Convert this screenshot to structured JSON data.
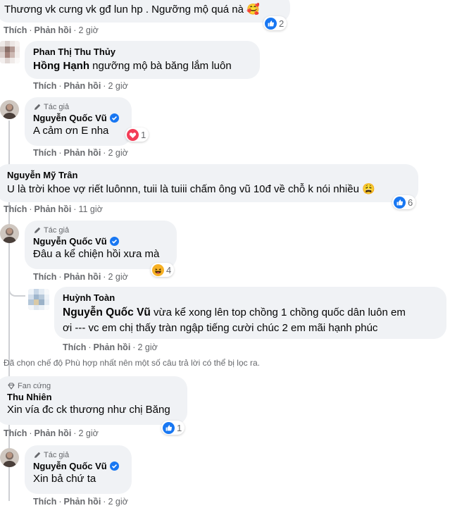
{
  "comments": [
    {
      "id": "c0",
      "text": "Thương vk cưng vk gđ lun hp . Ngưỡng mộ quá nà 🥰",
      "reaction_count": "2",
      "reaction_icon": "like-icon",
      "actions": {
        "like": "Thích",
        "reply": "Phản hồi",
        "time": "2 giờ"
      }
    },
    {
      "id": "c1",
      "author": "Phan Thị Thu Thủy",
      "mention": "Hồng Hạnh",
      "text": "ngưỡng mộ bà băng lắm luôn",
      "actions": {
        "like": "Thích",
        "reply": "Phản hồi",
        "time": "2 giờ"
      }
    },
    {
      "id": "c2",
      "badge": "Tác giả",
      "author": "Nguyễn Quốc Vũ",
      "text": "A cảm ơn E nha",
      "reaction_count": "1",
      "reaction_icon": "love-icon",
      "actions": {
        "like": "Thích",
        "reply": "Phản hồi",
        "time": "2 giờ"
      }
    },
    {
      "id": "c3",
      "author": "Nguyễn Mỹ Trân",
      "text": "U là trời khoe vợ riết luônnn, tuii là tuiii chấm ông vũ 10đ về chỗ k nói nhiều 😩",
      "reaction_count": "6",
      "reaction_icon": "like-icon",
      "actions": {
        "like": "Thích",
        "reply": "Phản hồi",
        "time": "11 giờ"
      }
    },
    {
      "id": "c4",
      "badge": "Tác giả",
      "author": "Nguyễn Quốc Vũ",
      "text": "Đâu a kể chiện hồi xưa mà",
      "reaction_count": "4",
      "reaction_icon": "haha-icon",
      "actions": {
        "like": "Thích",
        "reply": "Phản hồi",
        "time": "2 giờ"
      }
    },
    {
      "id": "c5",
      "author": "Huỳnh Toàn",
      "mention": "Nguyễn Quốc Vũ",
      "text_line1": "vừa kể xong lên top chồng 1 chồng quốc dân luôn em",
      "text_line2": "ơi --- vc em chị thấy tràn ngập tiếng cười chúc 2 em mãi hạnh phúc",
      "actions": {
        "like": "Thích",
        "reply": "Phản hồi",
        "time": "2 giờ"
      }
    },
    {
      "id": "c6",
      "badge": "Fan cứng",
      "author": "Thu Nhiên",
      "text": "Xin vía đc ck thương như chị Băng",
      "reaction_count": "1",
      "reaction_icon": "like-icon",
      "actions": {
        "like": "Thích",
        "reply": "Phản hồi",
        "time": "2 giờ"
      }
    },
    {
      "id": "c7",
      "badge": "Tác giả",
      "author": "Nguyễn Quốc Vũ",
      "text": "Xin bả chứ ta",
      "actions": {
        "like": "Thích",
        "reply": "Phản hồi",
        "time": "2 giờ"
      }
    }
  ],
  "filter_notice": "Đã chọn chế độ Phù hợp nhất nên một số câu trả lời có thể bị lọc ra.",
  "colors": {
    "bubble": "#f0f2f5",
    "muted": "#65676b",
    "like_blue": "#1877f2",
    "love_red": "#f33e58",
    "haha_yellow": "#f7b125",
    "thread": "#ced0d4"
  }
}
